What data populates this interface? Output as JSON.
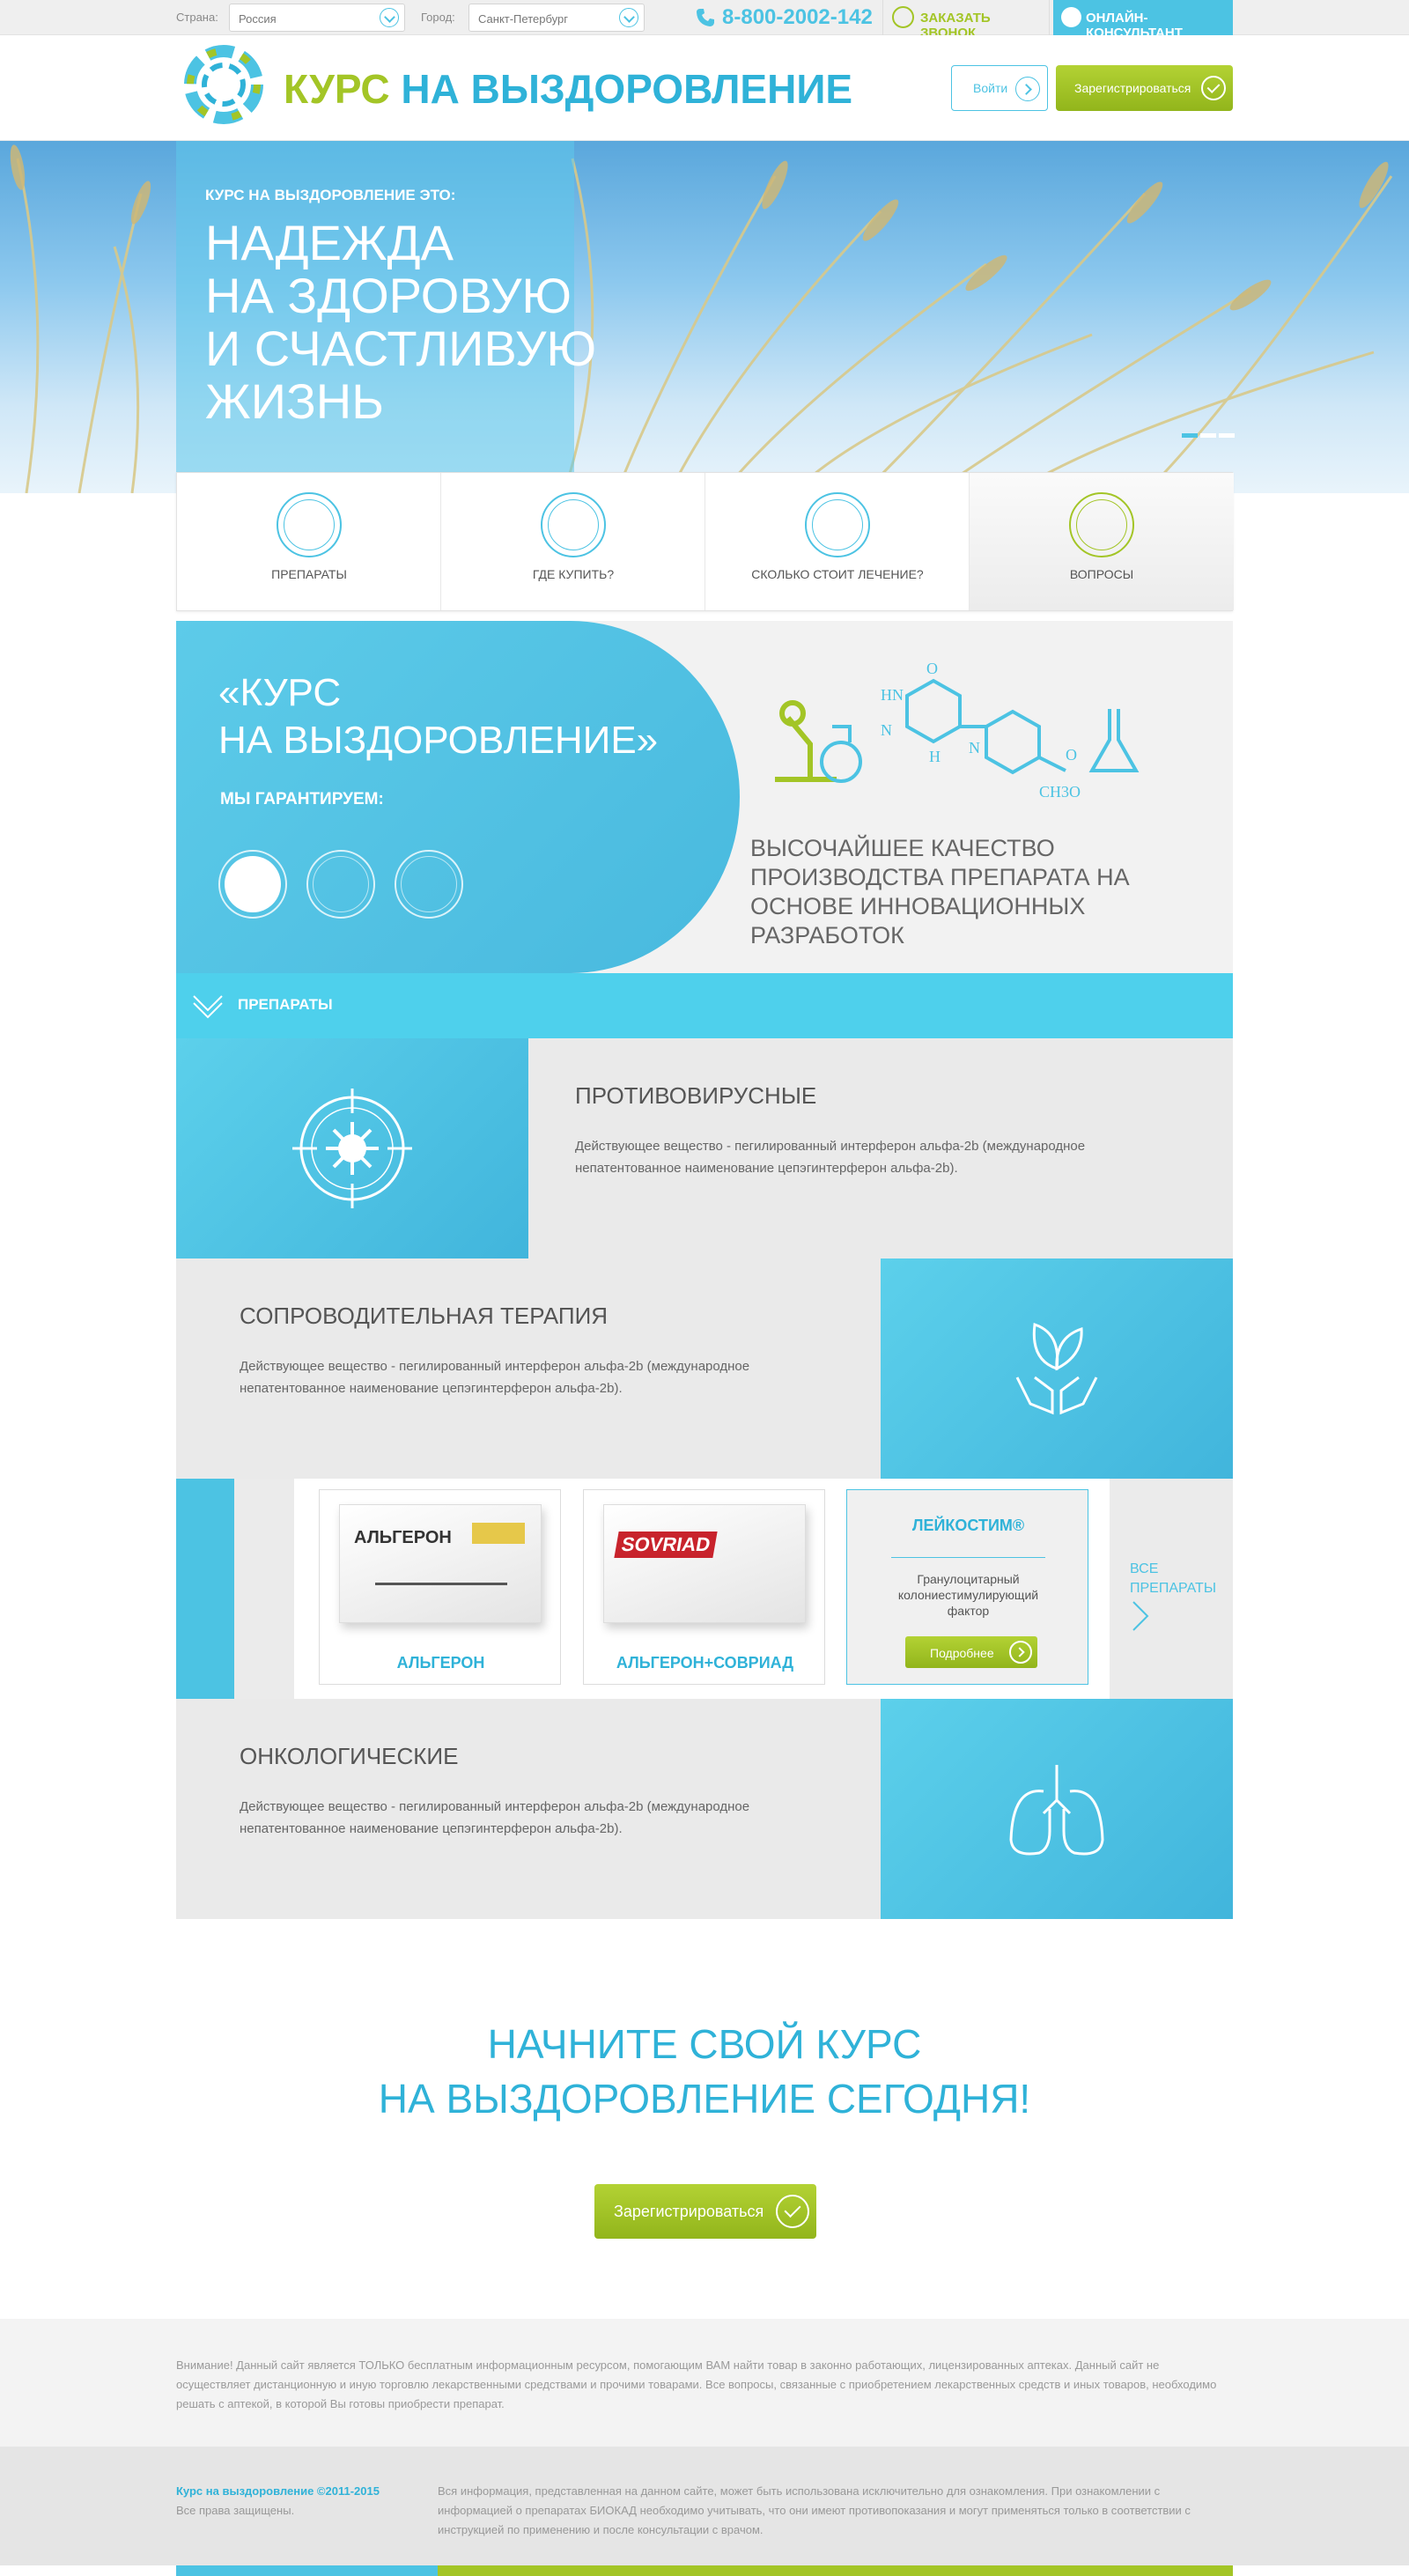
{
  "topbar": {
    "country_label": "Страна:",
    "country_value": "Россия",
    "city_label": "Город:",
    "city_value": "Санкт-Петербург",
    "phone": "8-800-2002-142",
    "callback_label": "ЗАКАЗАТЬ ЗВОНОК",
    "online_label": "ОНЛАЙН-КОНСУЛЬТАНТ"
  },
  "header": {
    "logo_green": "КУРС",
    "logo_blue": "НА ВЫЗДОРОВЛЕНИЕ",
    "login_label": "Войти",
    "register_label": "Зарегистрироваться"
  },
  "hero": {
    "subtitle": "КУРС НА ВЫЗДОРОВЛЕНИЕ ЭТО:",
    "title_lines": [
      "НАДЕЖДА",
      "НА ЗДОРОВУЮ",
      "И СЧАСТЛИВУЮ",
      "ЖИЗНЬ"
    ],
    "slides": 3,
    "active_slide": 1
  },
  "features": [
    {
      "label": "ПРЕПАРАТЫ",
      "icon": "molecule-icon"
    },
    {
      "label": "ГДЕ КУПИТЬ?",
      "icon": "map-pin-icon"
    },
    {
      "label": "СКОЛЬКО СТОИТ ЛЕЧЕНИЕ?",
      "icon": "ruble-icon"
    },
    {
      "label": "ВОПРОСЫ",
      "icon": "question-chat-icon"
    }
  ],
  "guarantee": {
    "title_line1": "«КУРС",
    "title_line2": "НА ВЫЗДОРОВЛЕНИЕ»",
    "subtitle": "МЫ ГАРАНТИРУЕМ:",
    "text": "ВЫСОЧАЙШЕЕ КАЧЕСТВО ПРОИЗВОДСТВА ПРЕПАРАТА НА ОСНОВЕ ИННОВАЦИОННЫХ РАЗРАБОТОК",
    "chem_labels": [
      "HN",
      "O",
      "N",
      "H",
      "N",
      "O",
      "CH3O"
    ]
  },
  "drugs": {
    "bar_title": "ПРЕПАРАТЫ",
    "categories": [
      {
        "title": "ПРОТИВОВИРУСНЫЕ",
        "desc": "Действующее вещество - пегилированный интерферон альфа-2b (международное непатентованное наименование цепэгинтерферон альфа-2b)."
      },
      {
        "title": "СОПРОВОДИТЕЛЬНАЯ ТЕРАПИЯ",
        "desc": "Действующее вещество - пегилированный интерферон альфа-2b (международное непатентованное наименование цепэгинтерферон альфа-2b)."
      },
      {
        "title": "ОНКОЛОГИЧЕСКИЕ",
        "desc": "Действующее вещество - пегилированный интерферон альфа-2b (международное непатентованное наименование цепэгинтерферон альфа-2b)."
      }
    ],
    "products": [
      {
        "name": "АЛЬГЕРОН",
        "box_brand": "АЛЬГЕРОН"
      },
      {
        "name": "АЛЬГЕРОН+СОВРИАД",
        "box_brand": "SOVRIAD"
      }
    ],
    "featured": {
      "name": "ЛЕЙКОСТИМ®",
      "desc": "Гранулоцитарный колониестимулирующий фактор",
      "button": "Подробнее"
    },
    "all_label": "ВСЕ ПРЕПАРАТЫ"
  },
  "cta": {
    "line1": "НАЧНИТЕ СВОЙ КУРС",
    "line2": "НА ВЫЗДОРОВЛЕНИЕ СЕГОДНЯ!",
    "button": "Зарегистрироваться"
  },
  "footer": {
    "notice": "Внимание! Данный сайт является ТОЛЬКО бесплатным информационным ресурсом, помогающим ВАМ найти товар в законно работающих, лицензированных аптеках. Данный сайт не осуществляет дистанционную и иную торговлю лекарственными средствами и прочими товарами. Все вопросы, связанные с приобретением лекарственных средств и иных товаров, необходимо решать с аптекой, в которой Вы готовы приобрести препарат.",
    "copyright": "Курс на выздоровление ©2011-2015",
    "rights": "Все права защищены.",
    "info": "Вся информация, представленная на данном сайте, может быть использована исключительно для ознакомления. При ознакомлении с информацией о препаратах БИОКАД необходимо учитывать, что они имеют противопоказания и могут применяться только в соответствии с инструкцией по применению и после консультации с врачом."
  },
  "colors": {
    "accent_blue": "#4cc3e3",
    "accent_green": "#a3c526",
    "logo_blue": "#2fb2d8"
  }
}
